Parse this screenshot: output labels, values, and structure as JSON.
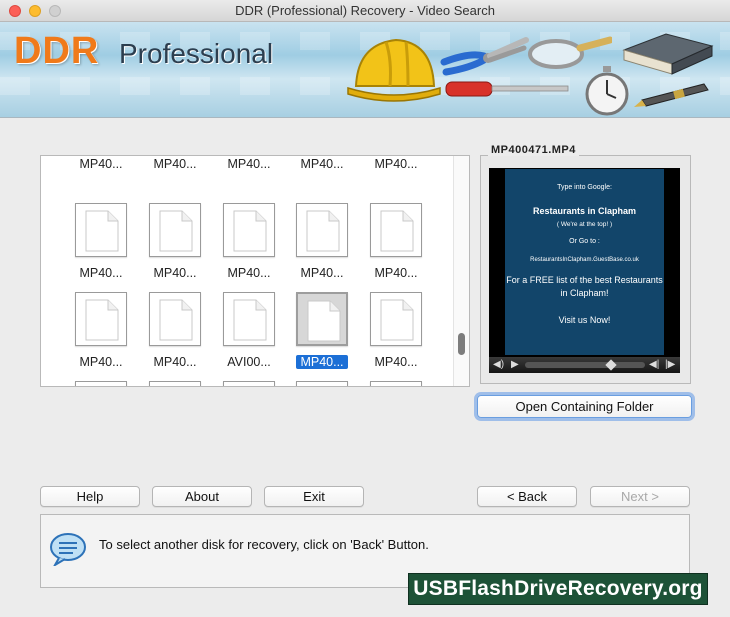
{
  "window": {
    "title": "DDR (Professional) Recovery - Video Search"
  },
  "banner": {
    "brand_ddr": "DDR",
    "brand_professional": "Professional"
  },
  "files": {
    "rows": [
      [
        "MP40...",
        "MP40...",
        "MP40...",
        "MP40...",
        "MP40..."
      ],
      [
        "MP40...",
        "MP40...",
        "MP40...",
        "MP40...",
        "MP40..."
      ],
      [
        "MP40...",
        "MP40...",
        "AVI00...",
        "MP40...",
        "MP40..."
      ]
    ],
    "selected": "MP40..."
  },
  "preview": {
    "title": "MP400471.MP4",
    "video_lines": [
      "Type into Google:",
      "Restaurants in Clapham",
      "( We're at the top! )",
      "Or Go to :",
      "RestaurantsInClapham.GuestBase.co.uk",
      "For a FREE list of the best Restaurants",
      "in Clapham!",
      "Visit us Now!"
    ],
    "open_folder_label": "Open Containing Folder"
  },
  "buttons": {
    "help": "Help",
    "about": "About",
    "exit": "Exit",
    "back": "< Back",
    "next": "Next >"
  },
  "status": {
    "message": "To select another disk for recovery, click on 'Back' Button."
  },
  "watermark": {
    "text": "USBFlashDriveRecovery.org"
  },
  "colors": {
    "brand_orange": "#f07a1a",
    "selection_blue": "#1c6fd6",
    "watermark_green": "#1d5237",
    "video_bg": "#12456a"
  }
}
